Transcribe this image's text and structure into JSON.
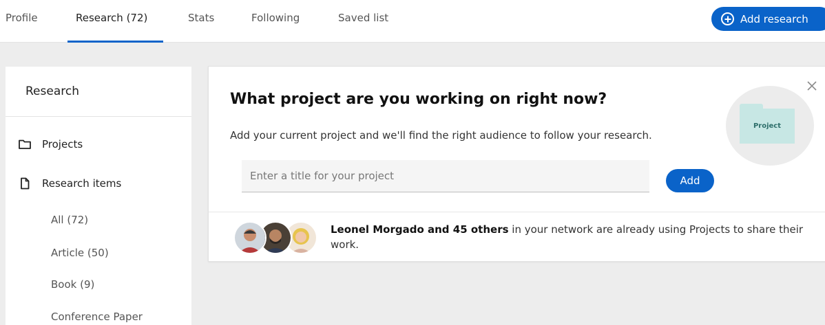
{
  "nav": {
    "tabs": [
      {
        "label": "Profile"
      },
      {
        "label": "Research (72)"
      },
      {
        "label": "Stats"
      },
      {
        "label": "Following"
      },
      {
        "label": "Saved list"
      }
    ],
    "active_tab": "Research (72)",
    "add_research_label": "Add research",
    "accent_color": "#0a63c9"
  },
  "sidebar": {
    "title": "Research",
    "items": [
      {
        "label": "Projects",
        "icon": "folder-icon"
      },
      {
        "label": "Research items",
        "icon": "document-icon"
      }
    ],
    "subitems": [
      {
        "label": "All (72)"
      },
      {
        "label": "Article (50)"
      },
      {
        "label": "Book (9)"
      },
      {
        "label": "Conference Paper"
      }
    ]
  },
  "card": {
    "title": "What project are you working on right now?",
    "description": "Add your current project and we'll find the right audience to follow your research.",
    "input_placeholder": "Enter a title for your project",
    "input_value": "",
    "add_label": "Add",
    "illustration_label": "Project",
    "close_icon": "close-icon",
    "network_bold": "Leonel Morgado and 45 others",
    "network_rest": " in your network are already using Projects to share their work."
  }
}
